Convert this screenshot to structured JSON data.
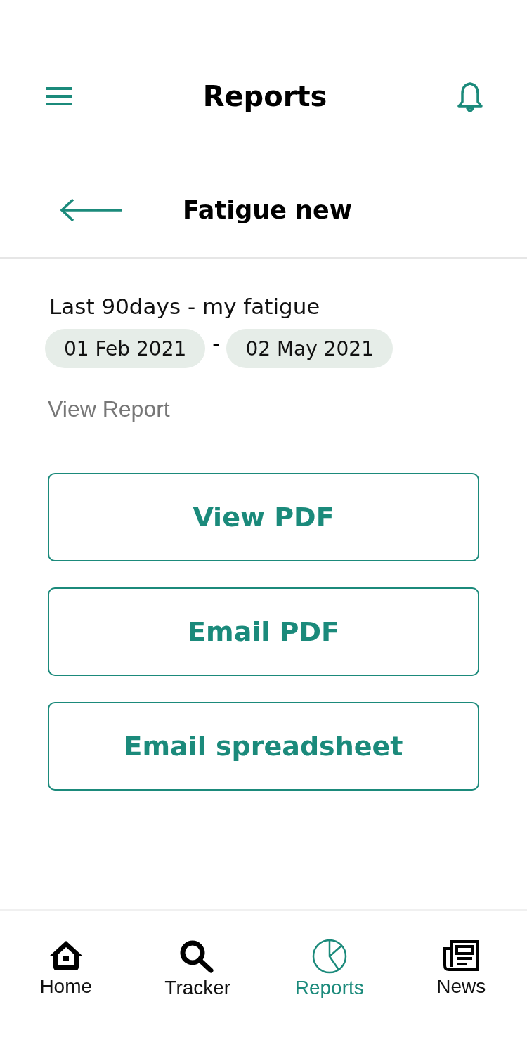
{
  "app_bar": {
    "title": "Reports"
  },
  "sub_header": {
    "title": "Fatigue new"
  },
  "report": {
    "name": "Last 90days - my fatigue",
    "start_date": "01 Feb 2021",
    "separator": "-",
    "end_date": "02 May 2021",
    "section_label": "View Report"
  },
  "actions": [
    "View PDF",
    "Email PDF",
    "Email spreadsheet"
  ],
  "bottom_nav": [
    {
      "label": "Home",
      "kind": "home",
      "selected": false
    },
    {
      "label": "Tracker",
      "kind": "search",
      "selected": false
    },
    {
      "label": "Reports",
      "kind": "chart",
      "selected": true
    },
    {
      "label": "News",
      "kind": "news",
      "selected": false
    }
  ]
}
